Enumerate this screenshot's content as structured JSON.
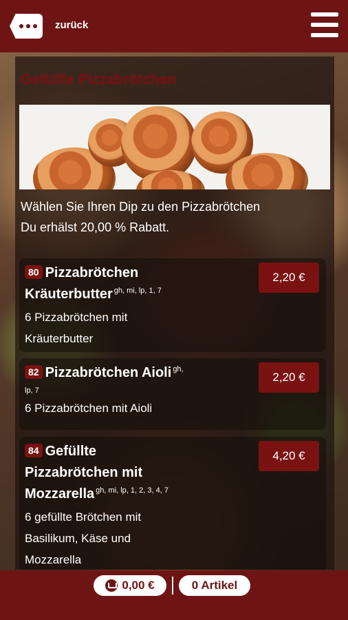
{
  "header": {
    "back_label": "zurück",
    "accent_color": "#6e1414"
  },
  "page": {
    "title": "Gefüllte Pizzabrötchen",
    "intro_line1": "Wählen Sie Ihren Dip zu den Pizzabrötchen",
    "intro_line2": "Du erhälst 20,00 % Rabatt."
  },
  "items": [
    {
      "number": "80",
      "name_line1": "Pizzabrötchen",
      "name_line2": "Kräuterbutter",
      "allergens": "gh, mi, lp, 1, 7",
      "description_line1": "6 Pizzabrötchen mit",
      "description_line2": "Kräuterbutter",
      "price": "2,20 €"
    },
    {
      "number": "82",
      "name_line1": "Pizzabrötchen Aioli",
      "allergens_part1": "gh,",
      "allergens_part2": "lp, 7",
      "description_line1": "6 Pizzabrötchen mit Aioli",
      "price": "2,20 €"
    },
    {
      "number": "84",
      "name_line1": "Gefüllte",
      "name_line2": "Pizzabrötchen mit",
      "name_line3": "Mozzarella",
      "allergens": "gh, mi, lp, 1, 2, 3, 4, 7",
      "description_line1": "6 gefüllte Brötchen mit",
      "description_line2": "Basilikum, Käse und",
      "description_line3": "Mozzarella",
      "price": "4,20 €"
    }
  ],
  "footer": {
    "cart_total": "0,00 €",
    "items_count": "0 Artikel",
    "cart_icon": "cart-icon"
  }
}
